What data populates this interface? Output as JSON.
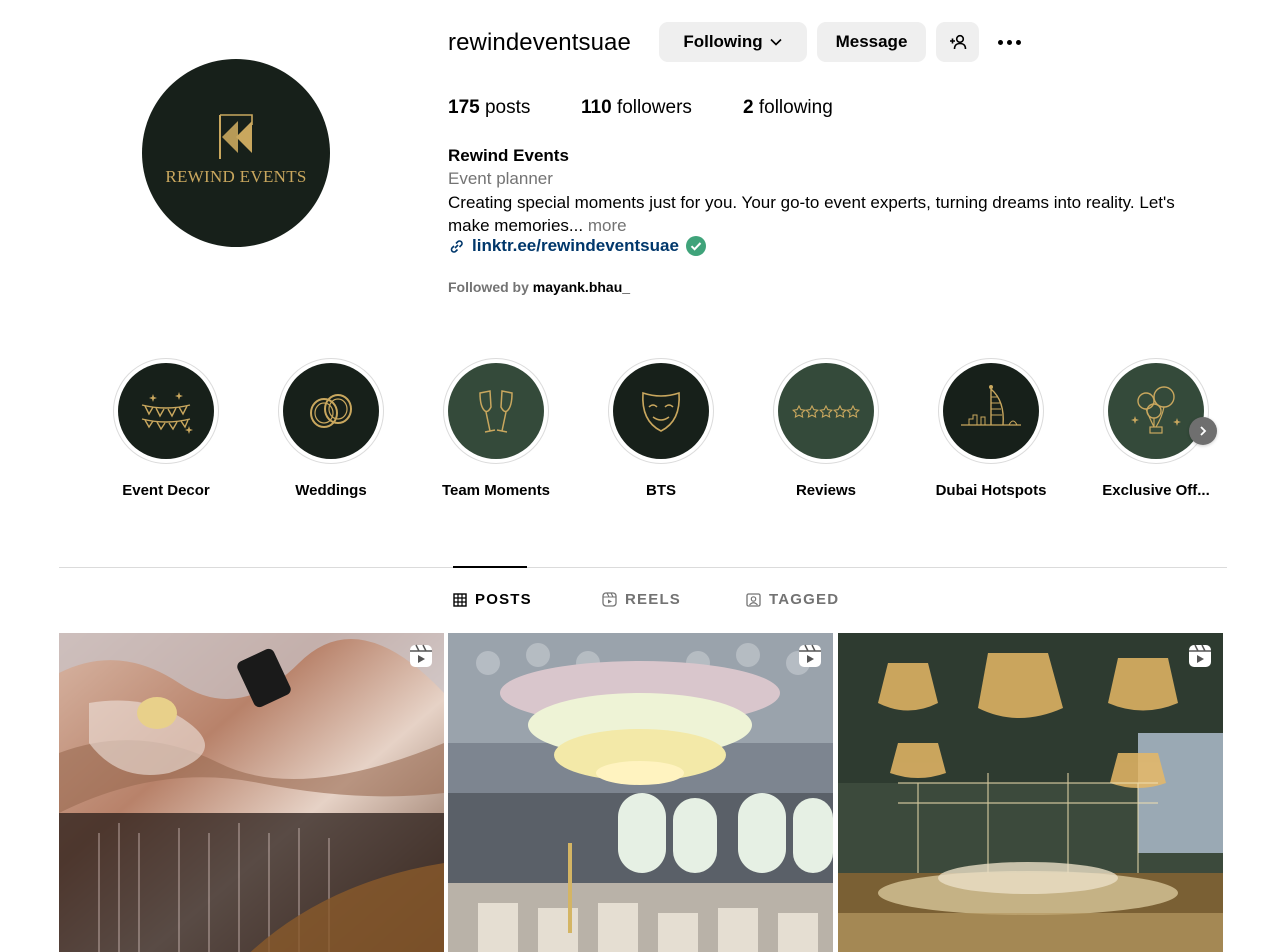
{
  "profile": {
    "avatar_text": "REWIND EVENTS",
    "username": "rewindeventsuae",
    "following_button": "Following",
    "message_button": "Message",
    "stats": {
      "posts_count": "175",
      "posts_label": "posts",
      "followers_count": "110",
      "followers_label": "followers",
      "following_count": "2",
      "following_label": "following"
    },
    "bio": {
      "name": "Rewind Events",
      "category": "Event planner",
      "text": "Creating special moments just for you. Your go-to event experts, turning dreams into reality. Let's make memories...",
      "more": "more",
      "link": "linktr.ee/rewindeventsuae"
    },
    "followed_by_prefix": "Followed by",
    "followed_by_user": "mayank.bhau_"
  },
  "highlights": [
    {
      "label": "Event Decor",
      "icon": "bunting-icon"
    },
    {
      "label": "Weddings",
      "icon": "rings-icon"
    },
    {
      "label": "Team Moments",
      "icon": "champagne-glasses-icon"
    },
    {
      "label": "BTS",
      "icon": "theater-mask-icon"
    },
    {
      "label": "Reviews",
      "icon": "stars-icon"
    },
    {
      "label": "Dubai Hotspots",
      "icon": "burj-al-arab-icon"
    },
    {
      "label": "Exclusive Off...",
      "icon": "balloons-icon"
    }
  ],
  "tabs": [
    {
      "label": "POSTS",
      "icon": "grid-icon",
      "active": true
    },
    {
      "label": "REELS",
      "icon": "reels-icon",
      "active": false
    },
    {
      "label": "TAGGED",
      "icon": "tagged-icon",
      "active": false
    }
  ],
  "posts": [
    {
      "type": "reel",
      "scene": "metallic foil decor with chandelier"
    },
    {
      "type": "reel",
      "scene": "floral chandelier ballroom"
    },
    {
      "type": "reel",
      "scene": "outdoor crystal chandeliers garden"
    }
  ],
  "colors": {
    "brand_dark": "#17201a",
    "brand_gold": "#c9a75e",
    "link": "#00376b",
    "muted": "#737373",
    "button_bg": "#efefef",
    "verified": "#3fa37a"
  }
}
